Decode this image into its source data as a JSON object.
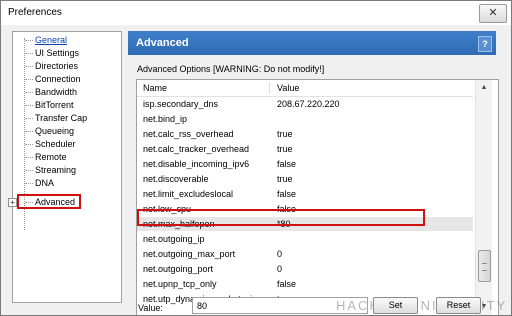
{
  "window": {
    "title": "Preferences",
    "close_glyph": "✕"
  },
  "sidebar": {
    "items": [
      {
        "label": "General"
      },
      {
        "label": "UI Settings"
      },
      {
        "label": "Directories"
      },
      {
        "label": "Connection"
      },
      {
        "label": "Bandwidth"
      },
      {
        "label": "BitTorrent"
      },
      {
        "label": "Transfer Cap"
      },
      {
        "label": "Queueing"
      },
      {
        "label": "Scheduler"
      },
      {
        "label": "Remote"
      },
      {
        "label": "Streaming"
      },
      {
        "label": "DNA"
      },
      {
        "label": "Advanced"
      }
    ],
    "selected": "General",
    "expander_glyph": "+"
  },
  "panel": {
    "title": "Advanced",
    "help_glyph": "?",
    "group_title": "Advanced Options [WARNING: Do not modify!]",
    "columns": {
      "name": "Name",
      "value": "Value"
    },
    "rows": [
      {
        "name": "isp.secondary_dns",
        "value": "208.67.220.220"
      },
      {
        "name": "net.bind_ip",
        "value": ""
      },
      {
        "name": "net.calc_rss_overhead",
        "value": "true"
      },
      {
        "name": "net.calc_tracker_overhead",
        "value": "true"
      },
      {
        "name": "net.disable_incoming_ipv6",
        "value": "false"
      },
      {
        "name": "net.discoverable",
        "value": "true"
      },
      {
        "name": "net.limit_excludeslocal",
        "value": "false"
      },
      {
        "name": "net.low_cpu",
        "value": "false"
      },
      {
        "name": "net.max_halfopen",
        "value": "*80"
      },
      {
        "name": "net.outgoing_ip",
        "value": ""
      },
      {
        "name": "net.outgoing_max_port",
        "value": "0"
      },
      {
        "name": "net.outgoing_port",
        "value": "0"
      },
      {
        "name": "net.upnp_tcp_only",
        "value": "false"
      },
      {
        "name": "net.utp_dynamic_packet_size",
        "value": "true"
      }
    ],
    "selected_row": "net.max_halfopen",
    "scroll_up_glyph": "▲",
    "scroll_down_glyph": "▼",
    "value_label": "Value:",
    "value_input": "80",
    "set_button": "Set",
    "reset_button": "Reset"
  },
  "watermark": "HACKINGUNIVERSITY",
  "colors": {
    "header_blue": "#2f6bb5",
    "highlight_red": "#d01010",
    "link_blue": "#0645ad"
  }
}
